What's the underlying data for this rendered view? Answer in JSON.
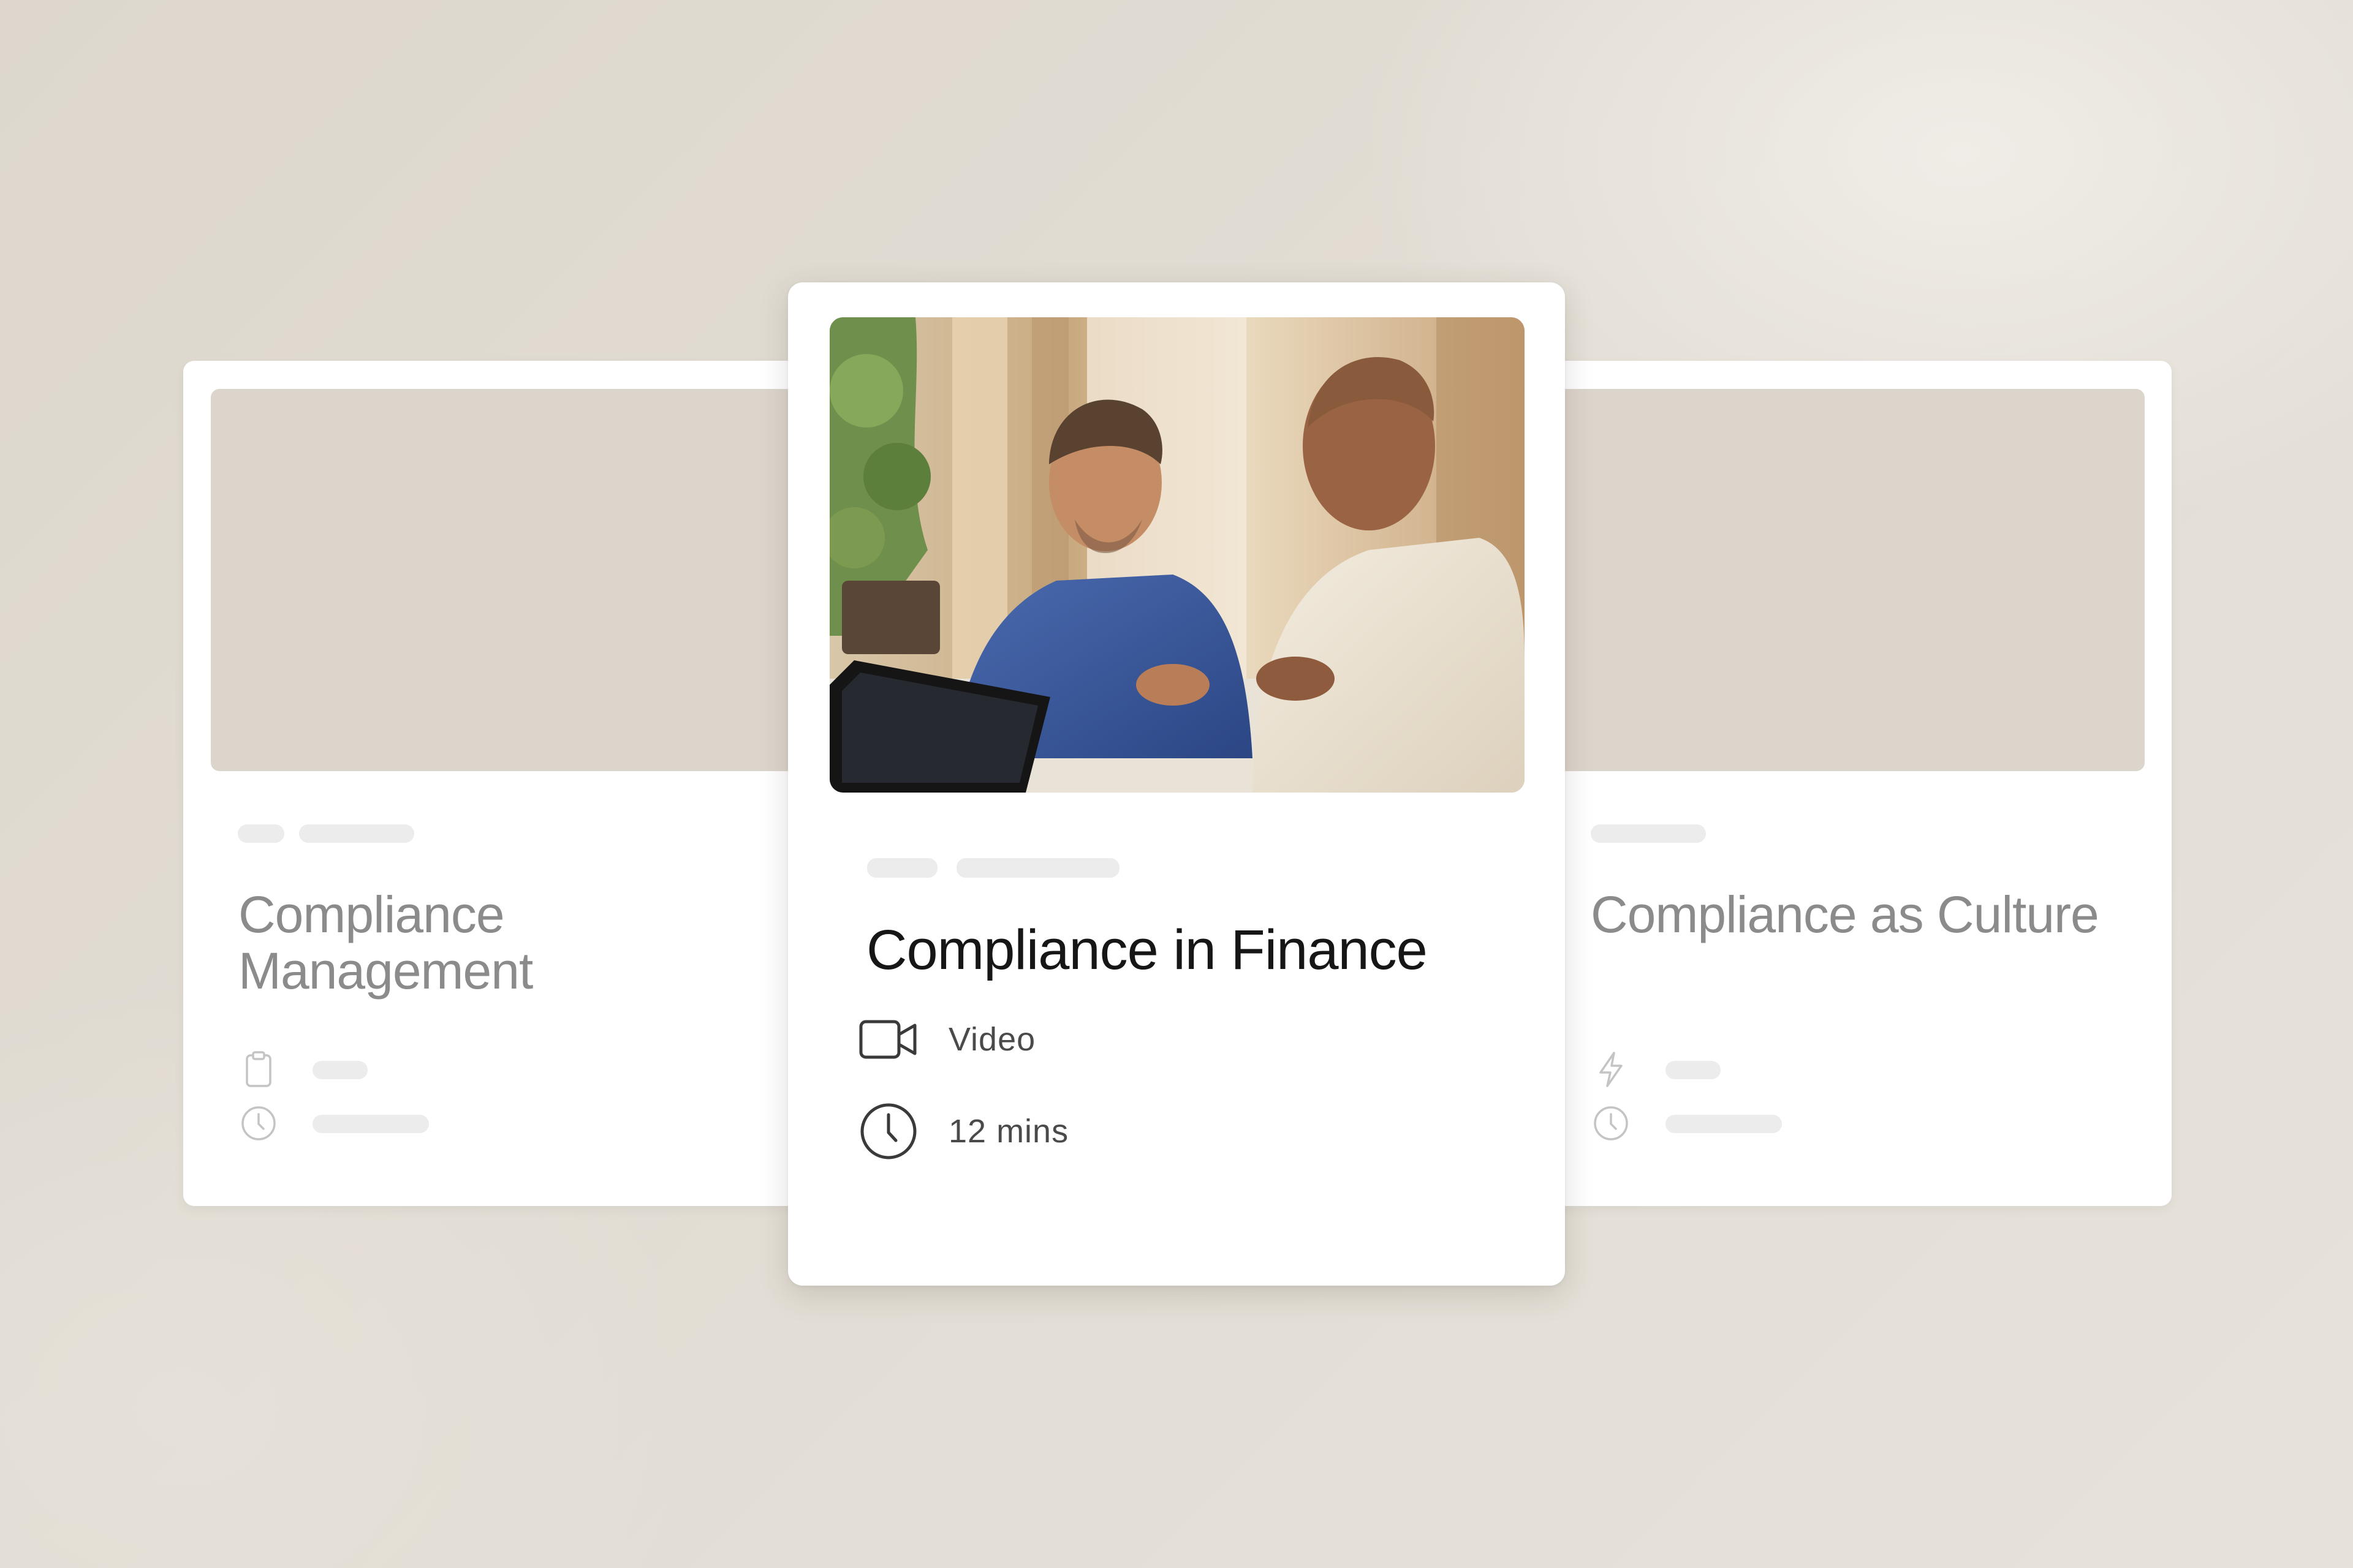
{
  "cards": [
    {
      "title": "Compliance Management",
      "title_lines": [
        "Compliance",
        "Management"
      ],
      "icons": [
        "clipboard-icon",
        "clock-icon"
      ]
    },
    {
      "title": "Compliance in Finance",
      "format_label": "Video",
      "duration_label": "12 mins",
      "icons": [
        "video-camera-icon",
        "clock-icon"
      ],
      "image": "two-men-reviewing-tablet-photo"
    },
    {
      "title": "Compliance as Culture",
      "icons": [
        "lightning-bolt-icon",
        "clock-icon"
      ]
    }
  ],
  "colors": {
    "background": "#e2ddd4",
    "card": "#ffffff",
    "placeholder_thumb": "#dcd5cc",
    "placeholder_bar": "#ececec",
    "muted_text": "#8b8b8b",
    "title_text": "#161616",
    "meta_text": "#4a4a4a"
  }
}
